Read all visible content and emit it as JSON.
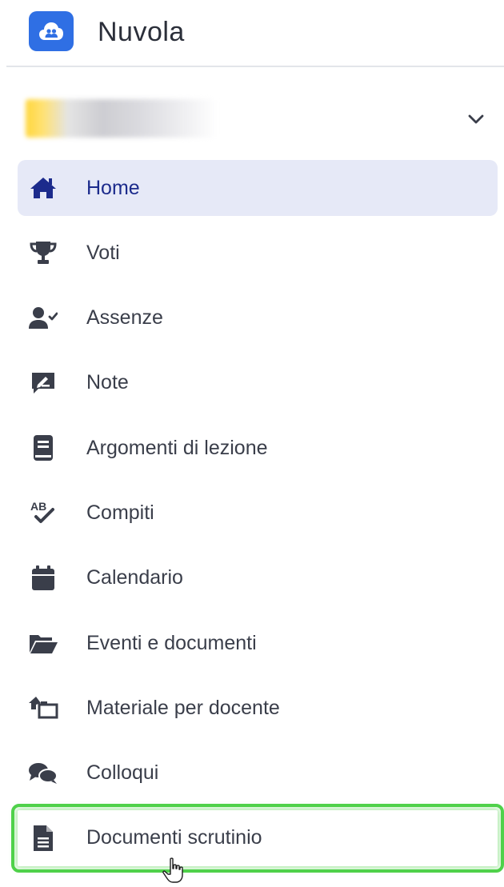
{
  "header": {
    "app_name": "Nuvola",
    "logo_icon": "cloud-people-icon",
    "brand_color": "#2f6fe4"
  },
  "user": {
    "name_visible": false,
    "dropdown_icon": "chevron-down-icon"
  },
  "nav": {
    "active_bg": "#e6e9f7",
    "active_color": "#1c2b8c",
    "highlight_color": "#4fd14a",
    "items": [
      {
        "label": "Home",
        "icon": "home-icon",
        "active": true
      },
      {
        "label": "Voti",
        "icon": "trophy-icon"
      },
      {
        "label": "Assenze",
        "icon": "user-check-icon"
      },
      {
        "label": "Note",
        "icon": "note-icon"
      },
      {
        "label": "Argomenti di lezione",
        "icon": "book-icon"
      },
      {
        "label": "Compiti",
        "icon": "spellcheck-icon"
      },
      {
        "label": "Calendario",
        "icon": "calendar-icon"
      },
      {
        "label": "Eventi e documenti",
        "icon": "folder-open-icon"
      },
      {
        "label": "Materiale per docente",
        "icon": "material-icon"
      },
      {
        "label": "Colloqui",
        "icon": "chat-icon"
      },
      {
        "label": "Documenti scrutinio",
        "icon": "document-icon",
        "highlighted": true
      }
    ]
  }
}
